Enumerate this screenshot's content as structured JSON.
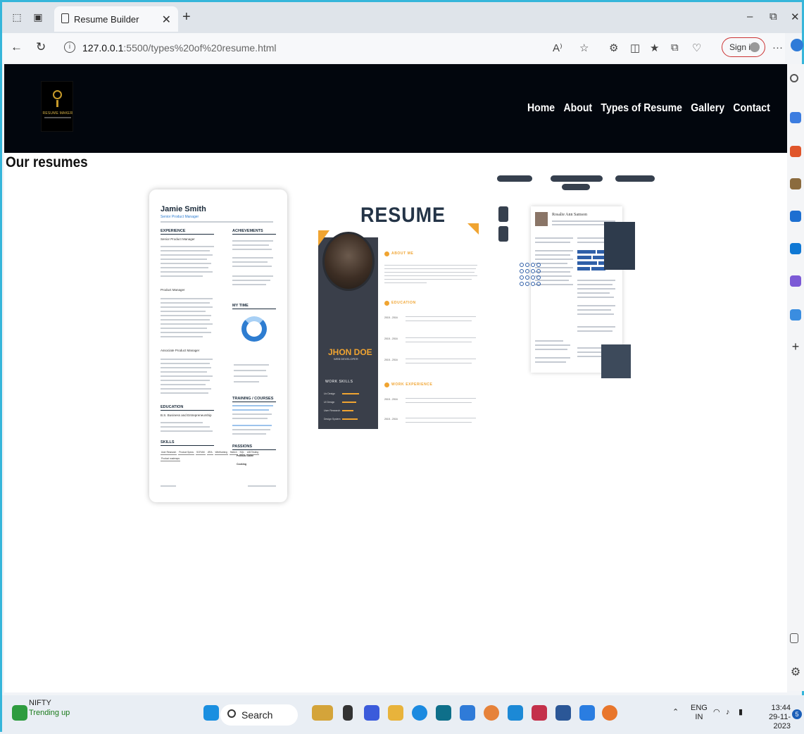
{
  "browser": {
    "tab_title": "Resume Builder",
    "url_host": "127.0.0.1",
    "url_path": ":5500/types%20of%20resume.html",
    "sign_in_label": "Sign in",
    "more_label": "···"
  },
  "site": {
    "logo_text": "RESUME MAKER",
    "nav": [
      "Home",
      "About",
      "Types of Resume",
      "Gallery",
      "Contact"
    ],
    "section_title": "Our resumes"
  },
  "resume_1": {
    "name": "Jamie Smith",
    "role": "Senior Product Manager",
    "headings": [
      "EXPERIENCE",
      "ACHIEVEMENTS",
      "MY TIME",
      "EDUCATION",
      "TRAINING / COURSES",
      "SKILLS",
      "PASSIONS"
    ],
    "job_1": "Senior Product Manager",
    "job_2": "Product Manager",
    "job_3": "Associate Product Manager",
    "degree": "B.S. Business and Entrepreneurship",
    "skills": [
      "User Research",
      "Product Specs",
      "SCRUM",
      "JIRA",
      "Wireframing",
      "Sketch",
      "SQL",
      "A/B Testing",
      "Product roadmaps"
    ],
    "passions": [
      "Political Satire",
      "Cooking"
    ]
  },
  "resume_2": {
    "title": "RESUME",
    "name": "JHON DOE",
    "role": "WEB DEVELOPER",
    "work_skills_heading": "WORK SKILLS",
    "skills": [
      "Ux Design",
      "UI Design",
      "User Research",
      "Design System"
    ],
    "about_heading": "ABOUT ME",
    "education_heading": "EDUCATION",
    "experience_heading": "WORK EXPERIENCE",
    "years": "2015 - 2016"
  },
  "resume_3": {
    "name": "Rosalie Ann Samson"
  },
  "taskbar": {
    "widget_title": "NIFTY",
    "widget_sub": "Trending up",
    "search_label": "Search",
    "lang_top": "ENG",
    "lang_bottom": "IN",
    "time": "13:44",
    "date": "29-11-2023",
    "notif_count": "5"
  },
  "colors": {
    "frame": "#36b6da",
    "site_header": "#02060d",
    "accent_orange": "#f0a431",
    "resume_blue": "#2e7dd1",
    "sign_in_border": "#cc3333"
  }
}
